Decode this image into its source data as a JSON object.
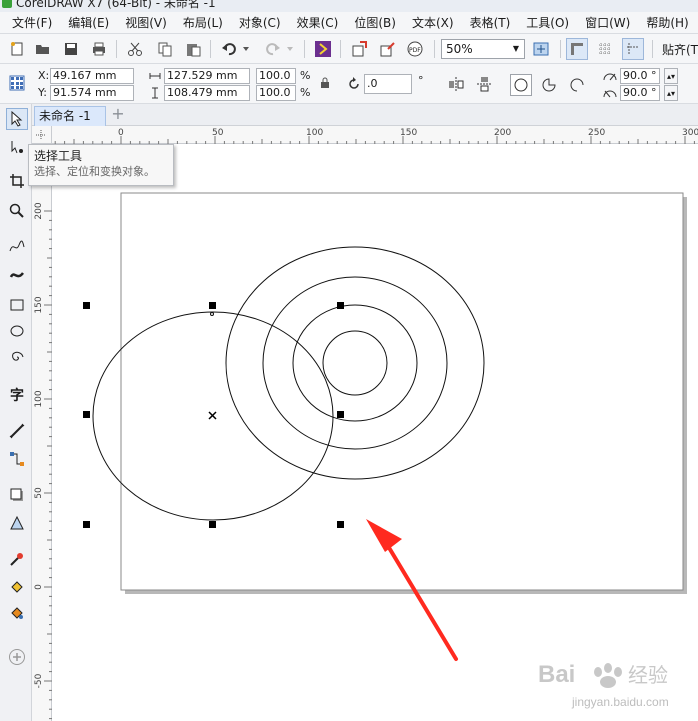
{
  "window": {
    "title": "CorelDRAW X7 (64-Bit) - 未命名 -1"
  },
  "menubar": {
    "items": [
      "文件(F)",
      "编辑(E)",
      "视图(V)",
      "布局(L)",
      "对象(C)",
      "效果(C)",
      "位图(B)",
      "文本(X)",
      "表格(T)",
      "工具(O)",
      "窗口(W)",
      "帮助(H)"
    ]
  },
  "toolbar": {
    "zoom_value": "50%",
    "snap_label": "贴齐(T)"
  },
  "propbar": {
    "x_label": "X:",
    "x_value": "49.167 mm",
    "y_label": "Y:",
    "y_value": "91.574 mm",
    "width_value": "127.529 mm",
    "height_value": "108.479 mm",
    "scale_x": "100.0",
    "scale_y": "100.0",
    "percent": "%",
    "rotation_value": ".0",
    "degree": "°",
    "angle_start": "90.0 °",
    "angle_end": "90.0 °"
  },
  "tabs": {
    "document_tab": "未命名 -1",
    "add_tab": "+"
  },
  "rulers": {
    "horizontal_labels": [
      "0",
      "50",
      "100",
      "150",
      "200",
      "250",
      "300"
    ],
    "vertical_labels": [
      "200",
      "150",
      "100",
      "50",
      "0",
      "-50"
    ]
  },
  "tooltip": {
    "title": "选择工具",
    "description": "选择、定位和变换对象。"
  },
  "watermark": {
    "brand": "Bai",
    "brand2": "经验",
    "url": "jingyan.baidu.com"
  },
  "colors": {
    "arrow": "#ff2a1f",
    "active_tab": "#dbe8fb",
    "chrome": "#f5f6f8"
  }
}
